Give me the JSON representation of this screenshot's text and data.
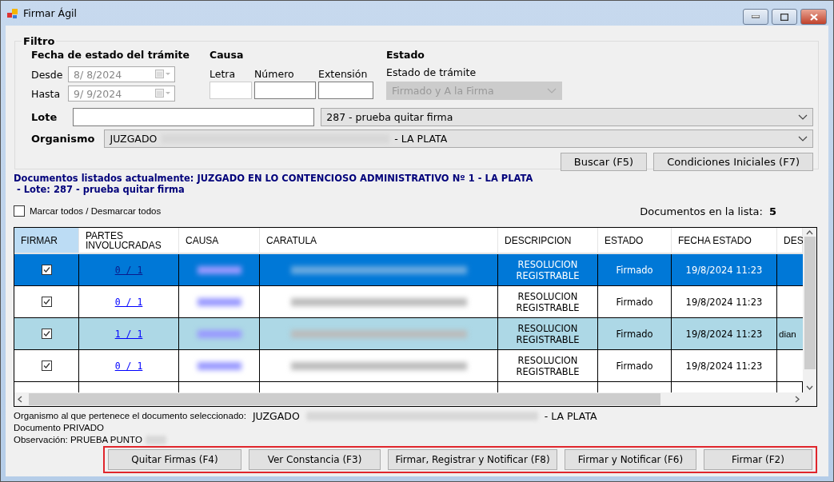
{
  "window": {
    "title": "Firmar Ágil"
  },
  "filter": {
    "title": "Filtro",
    "fecha": {
      "heading": "Fecha de estado del trámite",
      "desde_label": "Desde",
      "desde_value": "8/  8/2024",
      "hasta_label": "Hasta",
      "hasta_value": "9/  9/2024",
      "disabled": true
    },
    "causa": {
      "heading": "Causa",
      "letra_label": "Letra",
      "numero_label": "Número",
      "extension_label": "Extensión"
    },
    "estado": {
      "heading": "Estado",
      "label": "Estado de trámite",
      "value": "Firmado y A la Firma",
      "disabled": true
    },
    "lote": {
      "label": "Lote",
      "selected_text": "287 - prueba quitar firma"
    },
    "organismo": {
      "label": "Organismo",
      "prefix": "JUZGADO",
      "suffix": "- LA PLATA"
    },
    "buttons": [
      "Buscar (F5)",
      "Condiciones Iniciales (F7)"
    ]
  },
  "listing": {
    "line1": "Documentos listados actualmente: JUZGADO EN LO CONTENCIOSO ADMINISTRATIVO Nº 1 - LA PLATA",
    "line2": " - Lote: 287 - prueba quitar firma"
  },
  "select_all": {
    "label": "Marcar todos / Desmarcar todos",
    "checked": false
  },
  "count": {
    "label": "Documentos en la lista:",
    "value": "5"
  },
  "table": {
    "columns": [
      {
        "label": "FIRMAR",
        "selected": true
      },
      {
        "label": "PARTES INVOLUCRADAS",
        "selected": false
      },
      {
        "label": "CAUSA",
        "selected": false
      },
      {
        "label": "CARATULA",
        "selected": false
      },
      {
        "label": "DESCRIPCION",
        "selected": false
      },
      {
        "label": "ESTADO",
        "selected": false
      },
      {
        "label": "FECHA ESTADO",
        "selected": false
      },
      {
        "label": "DES",
        "selected": false
      }
    ],
    "rows": [
      {
        "selected": true,
        "highlighted": false,
        "firmar": true,
        "partes": "0 / 1",
        "descripcion": "RESOLUCION REGISTRABLE",
        "estado": "Firmado",
        "fecha": "19/8/2024 11:23"
      },
      {
        "selected": false,
        "highlighted": false,
        "firmar": true,
        "partes": "0 / 1",
        "descripcion": "RESOLUCION REGISTRABLE",
        "estado": "Firmado",
        "fecha": "19/8/2024 11:23"
      },
      {
        "selected": false,
        "highlighted": true,
        "firmar": true,
        "partes": "1 / 1",
        "descripcion": "RESOLUCION REGISTRABLE",
        "estado": "Firmado",
        "fecha": "19/8/2024 11:23",
        "destino": "dian"
      },
      {
        "selected": false,
        "highlighted": false,
        "firmar": true,
        "partes": "0 / 1",
        "descripcion": "RESOLUCION REGISTRABLE",
        "estado": "Firmado",
        "fecha": "19/8/2024 11:23"
      }
    ]
  },
  "details": {
    "organismo_label": "Organismo al que pertenece el documento seleccionado:",
    "organismo_prefix": "JUZGADO",
    "organismo_suffix": "- LA PLATA",
    "documento": "Documento PRIVADO",
    "observacion": "Observación: PRUEBA PUNTO"
  },
  "actions": [
    "Quitar Firmas (F4)",
    "Ver Constancia (F3)",
    "Firmar, Registrar  y Notificar (F8)",
    "Firmar  y Notificar (F6)",
    "Firmar (F2)"
  ]
}
